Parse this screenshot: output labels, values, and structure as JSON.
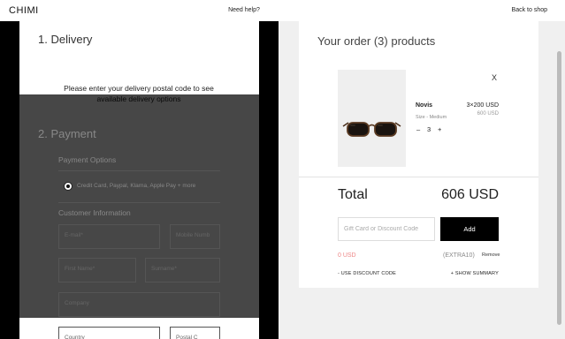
{
  "header": {
    "logo": "CHIMI",
    "help_link": "Need help?",
    "back_link": "Back to shop"
  },
  "checkout": {
    "delivery": {
      "title": "1. Delivery",
      "message": "Please enter your delivery postal code to see available delivery options"
    },
    "payment": {
      "title": "2. Payment",
      "options_heading": "Payment Options",
      "selected_option": "Credit Card, Paypal, Klarna, Apple Pay + more",
      "customer_heading": "Customer Information",
      "fields": {
        "email": "E-mail*",
        "mobile": "Mobile Numb",
        "first_name": "First Name*",
        "surname": "Surname*",
        "company": "Company",
        "country": "Country",
        "postal": "Postal C"
      }
    }
  },
  "order": {
    "title": "Your order (3) products",
    "remove_icon": "X",
    "item": {
      "name": "Novis",
      "size": "Size - Medium",
      "price": "3×200 USD",
      "original_price": "600 USD",
      "qty_minus": "–",
      "qty": "3",
      "qty_plus": "+"
    },
    "total_label": "Total",
    "total_value": "606 USD",
    "discount_placeholder": "Gift Card or Discount Code",
    "add_label": "Add",
    "discount_amount": "0 USD",
    "discount_code": "(EXTRA10)",
    "discount_remove": "Remove",
    "use_discount": "- USE DISCOUNT CODE",
    "show_summary": "+ SHOW SUMMARY"
  },
  "colors": {
    "accent": "#000000",
    "discount": "#ee8888"
  }
}
